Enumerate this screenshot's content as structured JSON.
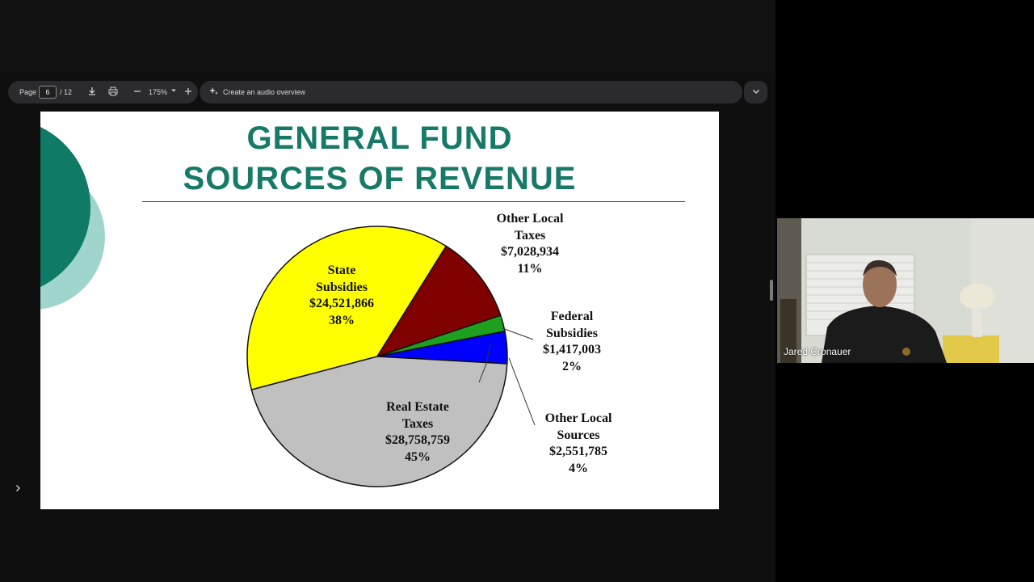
{
  "toolbar": {
    "page_label": "Page",
    "page_current": "6",
    "page_total": "/ 12",
    "zoom": "175%",
    "audio_overview": "Create an audio overview",
    "icons": [
      "download-icon",
      "print-icon",
      "minus-icon",
      "caret-down-icon",
      "plus-icon",
      "sparkle-icon",
      "chevron-down-icon"
    ]
  },
  "slide": {
    "title_line1": "GENERAL FUND",
    "title_line2": "SOURCES OF REVENUE",
    "colors": {
      "title": "#167a66",
      "accent_dark": "#0f7a66",
      "accent_light": "#9fd5cc"
    }
  },
  "chart_data": {
    "type": "pie",
    "slices": [
      {
        "name": "State Subsidies",
        "amount": "$24,521,866",
        "percent": 38,
        "pct_text": "38%",
        "color": "#ffff00"
      },
      {
        "name": "Other Local Taxes",
        "amount": "$7,028,934",
        "percent": 11,
        "pct_text": "11%",
        "color": "#800000"
      },
      {
        "name": "Federal Subsidies",
        "amount": "$1,417,003",
        "percent": 2,
        "pct_text": "2%",
        "color": "#1ea01e"
      },
      {
        "name": "Other Local Sources",
        "amount": "$2,551,785",
        "percent": 4,
        "pct_text": "4%",
        "color": "#0000ff"
      },
      {
        "name": "Real Estate Taxes",
        "amount": "$28,758,759",
        "percent": 45,
        "pct_text": "45%",
        "color": "#c0c0c0"
      }
    ],
    "labels": {
      "state": [
        "State",
        "Subsidies",
        "$24,521,866",
        "38%"
      ],
      "other_taxes": [
        "Other Local",
        "Taxes",
        "$7,028,934",
        "11%"
      ],
      "federal": [
        "Federal",
        "Subsidies",
        "$1,417,003",
        "2%"
      ],
      "other_sources": [
        "Other Local",
        "Sources",
        "$2,551,785",
        "4%"
      ],
      "real_estate": [
        "Real Estate",
        "Taxes",
        "$28,758,759",
        "45%"
      ]
    }
  },
  "video": {
    "participant_name": "Jared Cronauer"
  },
  "sidebar": {
    "expand_icon": "chevron-right-icon"
  }
}
